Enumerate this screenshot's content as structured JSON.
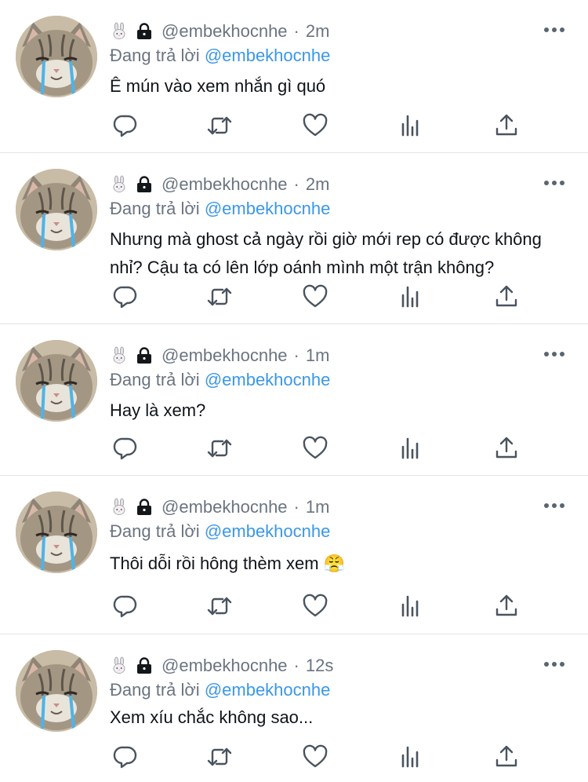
{
  "tweets": [
    {
      "handle": "@embekhocnhe",
      "time": "2m",
      "replying_prefix": "Đang trả lời ",
      "mention": "@embekhocnhe",
      "text": "Ê mún vào xem nhắn gì quó"
    },
    {
      "handle": "@embekhocnhe",
      "time": "2m",
      "replying_prefix": "Đang trả lời ",
      "mention": "@embekhocnhe",
      "text": "Nhưng mà ghost cả ngày rồi giờ mới rep có được không nhỉ? Cậu ta có lên lớp oánh mình một trận không?"
    },
    {
      "handle": "@embekhocnhe",
      "time": "1m",
      "replying_prefix": "Đang trả lời ",
      "mention": "@embekhocnhe",
      "text": "Hay là xem?"
    },
    {
      "handle": "@embekhocnhe",
      "time": "1m",
      "replying_prefix": "Đang trả lời ",
      "mention": "@embekhocnhe",
      "text": "Thôi dỗi rồi hông thèm xem 😤"
    },
    {
      "handle": "@embekhocnhe",
      "time": "12s",
      "replying_prefix": "Đang trả lời ",
      "mention": "@embekhocnhe",
      "text": "Xem xíu chắc không sao..."
    }
  ],
  "separator": "·",
  "icons": {
    "name_emoji": "rabbit-icon",
    "protected": "lock-icon",
    "more": "more-icon",
    "actions": [
      "reply-icon",
      "retweet-icon",
      "like-icon",
      "analytics-icon",
      "share-icon"
    ]
  },
  "colors": {
    "accent": "#3a97e8",
    "muted": "#6b7480",
    "text": "#0f1419",
    "divider": "#e1e4e8"
  }
}
